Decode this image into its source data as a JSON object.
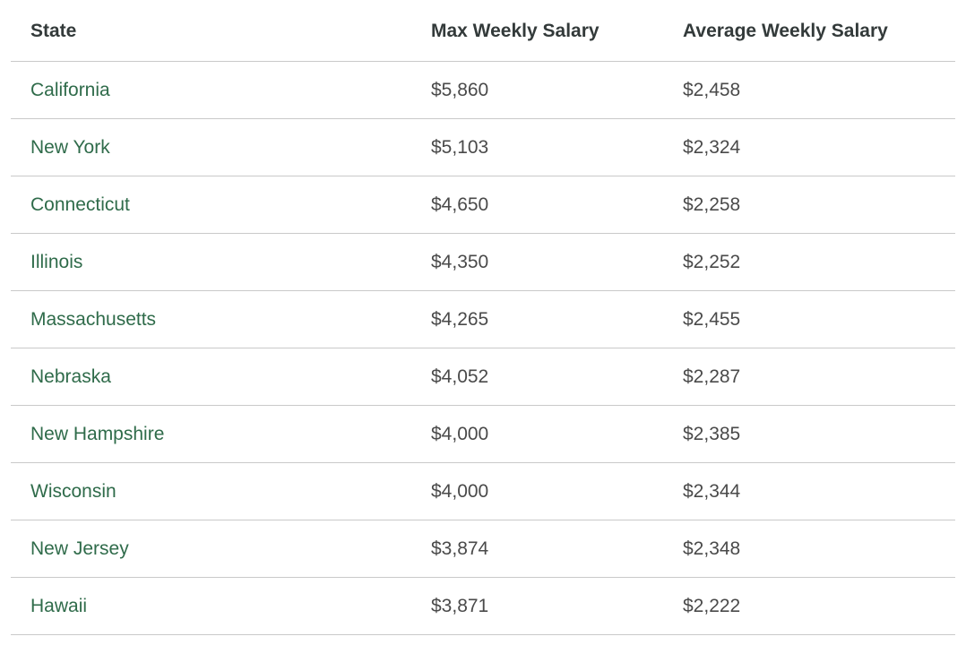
{
  "table": {
    "headers": [
      "State",
      "Max Weekly Salary",
      "Average Weekly Salary"
    ],
    "rows": [
      [
        "California",
        "$5,860",
        "$2,458"
      ],
      [
        "New York",
        "$5,103",
        "$2,324"
      ],
      [
        "Connecticut",
        "$4,650",
        "$2,258"
      ],
      [
        "Illinois",
        "$4,350",
        "$2,252"
      ],
      [
        "Massachusetts",
        "$4,265",
        "$2,455"
      ],
      [
        "Nebraska",
        "$4,052",
        "$2,287"
      ],
      [
        "New Hampshire",
        "$4,000",
        "$2,385"
      ],
      [
        "Wisconsin",
        "$4,000",
        "$2,344"
      ],
      [
        "New Jersey",
        "$3,874",
        "$2,348"
      ],
      [
        "Hawaii",
        "$3,871",
        "$2,222"
      ]
    ]
  },
  "colors": {
    "state_link": "#2f6b4a",
    "header_text": "#333a3a",
    "cell_text": "#4a4a4a",
    "divider": "#c9c9c9"
  }
}
